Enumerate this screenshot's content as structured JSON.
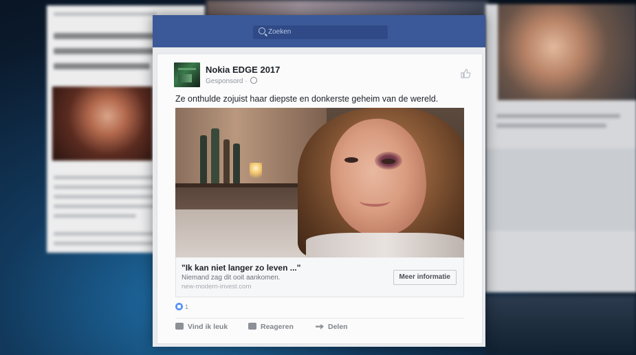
{
  "search": {
    "placeholder": "Zoeken"
  },
  "post": {
    "page_name": "Nokia EDGE 2017",
    "sponsored": "Gesponsord · ",
    "text": "Ze onthulde zojuist haar diepste en donkerste geheim van de wereld.",
    "ad": {
      "headline": "\"Ik kan niet langer zo leven ...\"",
      "description": "Niemand zag dit ooit aankomen.",
      "domain": "new-modern-invest.com",
      "cta": "Meer informatie"
    },
    "reaction_count": "1",
    "actions": {
      "like": "Vind ik leuk",
      "comment": "Reageren",
      "share": "Delen"
    }
  },
  "colors": {
    "fb_blue": "#3b5998",
    "background": "#e9ebee"
  }
}
